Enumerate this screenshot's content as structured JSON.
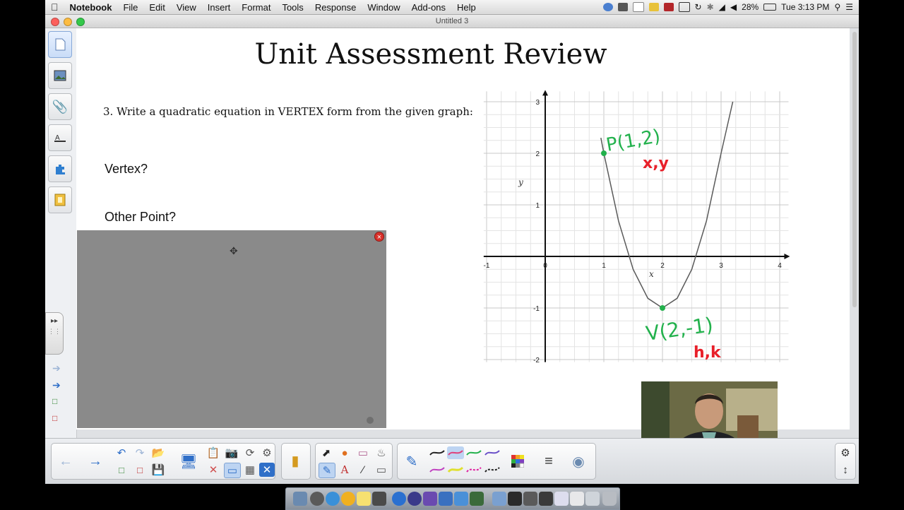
{
  "menubar": {
    "app_name": "Notebook",
    "items": [
      "File",
      "Edit",
      "View",
      "Insert",
      "Format",
      "Tools",
      "Response",
      "Window",
      "Add-ons",
      "Help"
    ],
    "battery": "28%",
    "clock": "Tue 3:13 PM"
  },
  "window": {
    "title": "Untitled 3"
  },
  "page": {
    "title": "Unit Assessment Review",
    "question": "3.  Write a quadratic equation in VERTEX form from the given graph:",
    "vertex_label": "Vertex?",
    "other_point_label": "Other Point?"
  },
  "graph": {
    "x_ticks": [
      "-1",
      "0",
      "1",
      "2",
      "3",
      "4"
    ],
    "y_ticks": [
      "3",
      "2",
      "1",
      "-1",
      "-2"
    ],
    "x_label": "x",
    "y_label": "y",
    "annotations": {
      "point_p": "P(1,2)",
      "point_xy": "x,y",
      "vertex_v": "V(2,-1)",
      "vertex_hk": "h,k"
    }
  },
  "chart_data": {
    "type": "line",
    "title": "",
    "xlabel": "x",
    "ylabel": "y",
    "xlim": [
      -1,
      4
    ],
    "ylim": [
      -2,
      3
    ],
    "grid": true,
    "series": [
      {
        "x": [
          0.95,
          1,
          1.25,
          1.5,
          1.75,
          2,
          2.25,
          2.5,
          2.75,
          3,
          3.2
        ],
        "y": [
          2.3,
          2,
          0.6875,
          -0.25,
          -0.8125,
          -1,
          -0.8125,
          -0.25,
          0.6875,
          2,
          3.0
        ]
      }
    ],
    "points": [
      {
        "x": 1,
        "y": 2,
        "label": "P(1,2)"
      },
      {
        "x": 2,
        "y": -1,
        "label": "V(2,-1)"
      }
    ]
  },
  "colors": {
    "annotation_green": "#22b14c",
    "annotation_red": "#e8202a",
    "curve": "#5a5a5a",
    "shade": "#8a8a8a"
  },
  "sidebar_tabs": [
    "page-sorter-icon",
    "gallery-icon",
    "attachments-icon",
    "properties-icon",
    "add-ons-icon",
    "lesson-activity-icon"
  ]
}
